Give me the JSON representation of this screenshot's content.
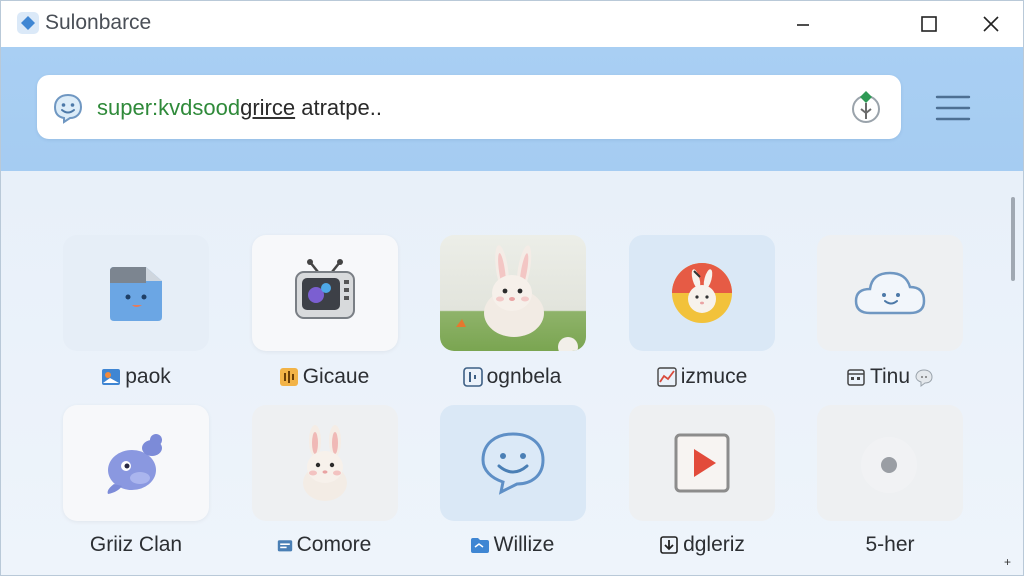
{
  "window": {
    "title": "Sulonbarce"
  },
  "search": {
    "query_green": "super:kvdsood",
    "query_underlined": "grirce",
    "query_rest": " atratpe.."
  },
  "grid": {
    "row1": [
      {
        "label": "paok"
      },
      {
        "label": "Gicaue"
      },
      {
        "label": "ognbela"
      },
      {
        "label": "izmuce"
      },
      {
        "label": "Tinu"
      }
    ],
    "row2": [
      {
        "label": "Griiz Clan"
      },
      {
        "label": "Comore"
      },
      {
        "label": "Willize"
      },
      {
        "label": "dgleriz"
      },
      {
        "label": "5-her"
      }
    ]
  },
  "colors": {
    "accent": "#a9cff3",
    "query_green": "#2f8a3a"
  },
  "icons": {
    "app": "app-diamond-icon",
    "search_logo": "smiley-bubble-icon",
    "mic": "mic-icon",
    "menu": "hamburger-menu-icon"
  },
  "corner_mark": "+"
}
